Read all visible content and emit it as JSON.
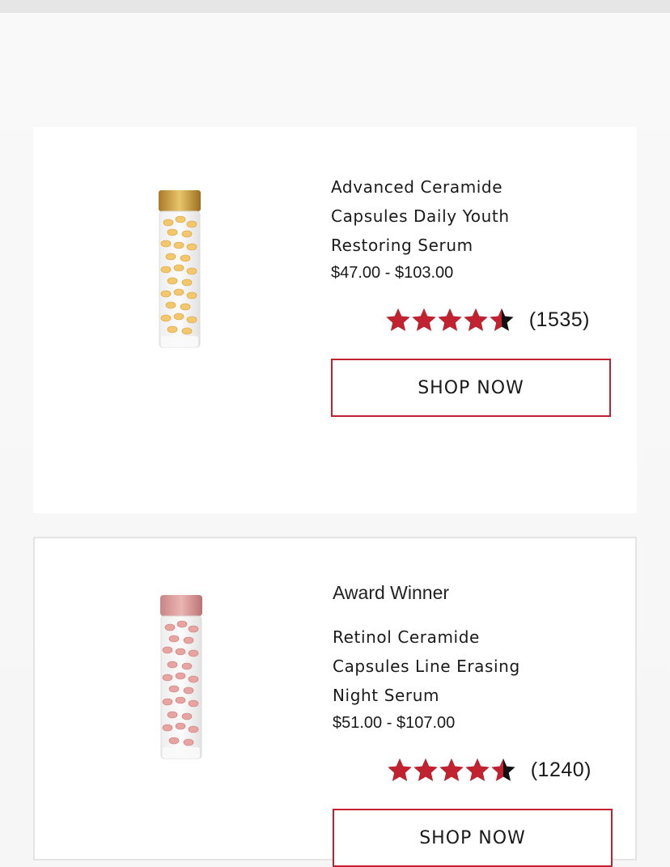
{
  "colors": {
    "accent": "#c2212f",
    "star_fill": "#c2212f",
    "star_empty": "#111111",
    "card_bg": "#ffffff",
    "page_bg": "#f6f6f6"
  },
  "products": [
    {
      "title_lines": [
        "Advanced Ceramide",
        "Capsules Daily Youth",
        "Restoring Serum"
      ],
      "price": "$47.00 - $103.00",
      "rating": 4.5,
      "review_count": "(1535)",
      "button_label": "SHOP NOW",
      "image_icon": "gold-capsule-bottle-icon"
    },
    {
      "badge": "Award Winner",
      "title_lines": [
        "Retinol Ceramide",
        "Capsules Line Erasing",
        "Night Serum"
      ],
      "price": "$51.00 - $107.00",
      "rating": 4.5,
      "review_count": "(1240)",
      "button_label": "SHOP NOW",
      "image_icon": "pink-capsule-bottle-icon"
    }
  ]
}
